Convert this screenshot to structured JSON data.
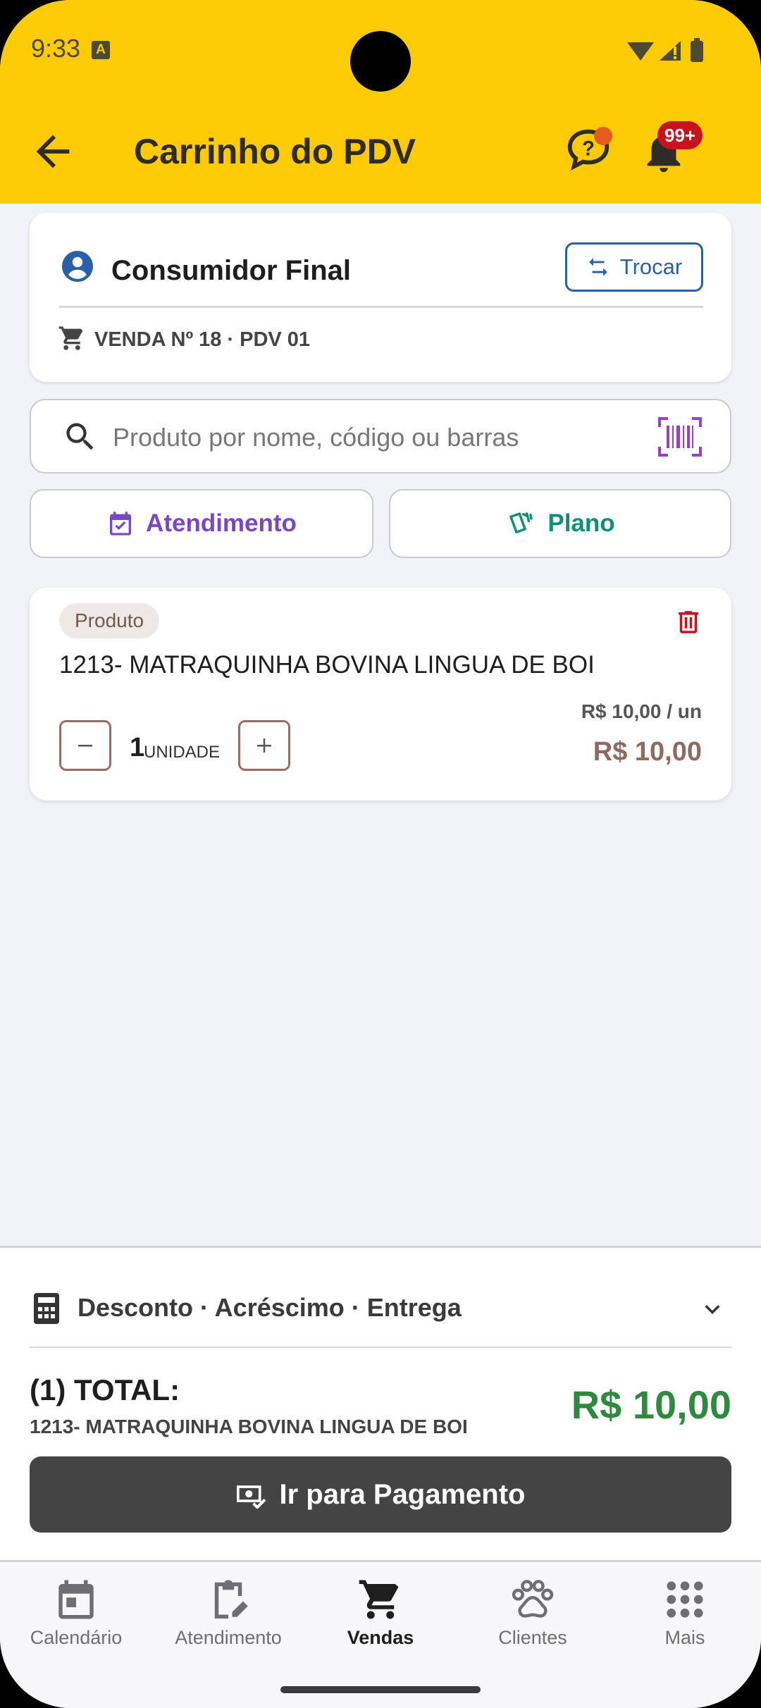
{
  "status_bar": {
    "time": "9:33",
    "indicator": "A"
  },
  "header": {
    "title": "Carrinho do PDV",
    "notifications_badge": "99+"
  },
  "customer": {
    "name": "Consumidor Final",
    "swap_label": "Trocar",
    "sale_info": "VENDA Nº 18 · PDV 01"
  },
  "search": {
    "placeholder": "Produto por nome, código ou barras",
    "value": ""
  },
  "actions": {
    "attendance_label": "Atendimento",
    "plan_label": "Plano"
  },
  "cart_items": [
    {
      "type_label": "Produto",
      "name": "1213- MATRAQUINHA BOVINA LINGUA DE BOI",
      "unit_price": "R$ 10,00 / un",
      "quantity": "1",
      "unit": "UNIDADE",
      "total": "R$ 10,00"
    }
  ],
  "summary": {
    "adjustments_label": "Desconto · Acréscimo · Entrega",
    "total_label": "(1) TOTAL:",
    "total_description": "1213- MATRAQUINHA BOVINA LINGUA DE BOI",
    "total_value": "R$ 10,00",
    "pay_button_label": "Ir para Pagamento"
  },
  "bottom_nav": [
    {
      "label": "Calendário",
      "icon": "calendar-icon"
    },
    {
      "label": "Atendimento",
      "icon": "clipboard-edit-icon"
    },
    {
      "label": "Vendas",
      "icon": "cart-icon",
      "active": true
    },
    {
      "label": "Clientes",
      "icon": "paw-icon"
    },
    {
      "label": "Mais",
      "icon": "grid-dots-icon"
    }
  ],
  "colors": {
    "appbar": "#fccb06",
    "accent_blue": "#2b5fa8",
    "accent_purple": "#7a46c8",
    "accent_teal": "#0f8f79",
    "total_green": "#2e8b3e",
    "badge_red": "#c8121c"
  }
}
